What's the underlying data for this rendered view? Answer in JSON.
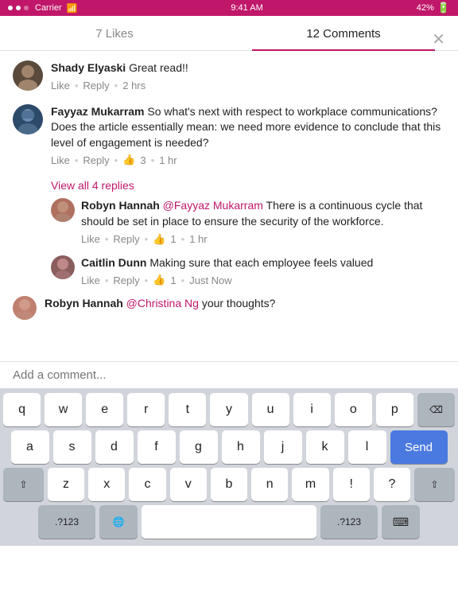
{
  "statusBar": {
    "carrier": "Carrier",
    "time": "9:41 AM",
    "battery": "42%"
  },
  "tabs": [
    {
      "id": "likes",
      "label": "7 Likes",
      "active": false
    },
    {
      "id": "comments",
      "label": "12 Comments",
      "active": true
    }
  ],
  "comments": [
    {
      "id": "c1",
      "author": "Shady Elyaski",
      "text": "Great read!!",
      "time": "2 hrs",
      "likes": 0,
      "replies": []
    },
    {
      "id": "c2",
      "author": "Fayyaz Mukarram",
      "text": "So what's next with respect to workplace communications? Does the article essentially mean: we need more evidence to conclude that this level of engagement is needed?",
      "time": "1 hr",
      "likes": 3,
      "viewRepliesLabel": "View all 4 replies",
      "replies": [
        {
          "id": "r1",
          "author": "Robyn Hannah",
          "mention": "@Fayyaz Mukarram",
          "text": " There is a continuous cycle that should be set in place to ensure the security of the workforce.",
          "time": "1 hr",
          "likes": 1
        },
        {
          "id": "r2",
          "author": "Caitlin Dunn",
          "text": "Making sure that each employee feels valued",
          "time": "Just Now",
          "likes": 1
        }
      ]
    }
  ],
  "typingComment": {
    "author": "Robyn Hannah",
    "mention": "@Christina Ng",
    "text": " your thoughts?",
    "placeholder": "Add a comment..."
  },
  "actions": {
    "like": "Like",
    "reply": "Reply"
  },
  "keyboard": {
    "rows": [
      [
        "q",
        "w",
        "e",
        "r",
        "t",
        "y",
        "u",
        "i",
        "o",
        "p"
      ],
      [
        "a",
        "s",
        "d",
        "f",
        "g",
        "h",
        "j",
        "k",
        "l"
      ],
      [
        "z",
        "x",
        "c",
        "v",
        "b",
        "n",
        "m"
      ],
      [
        "?123",
        "🌐",
        "space",
        ".?123",
        "⌨"
      ]
    ],
    "sendLabel": "Send"
  }
}
